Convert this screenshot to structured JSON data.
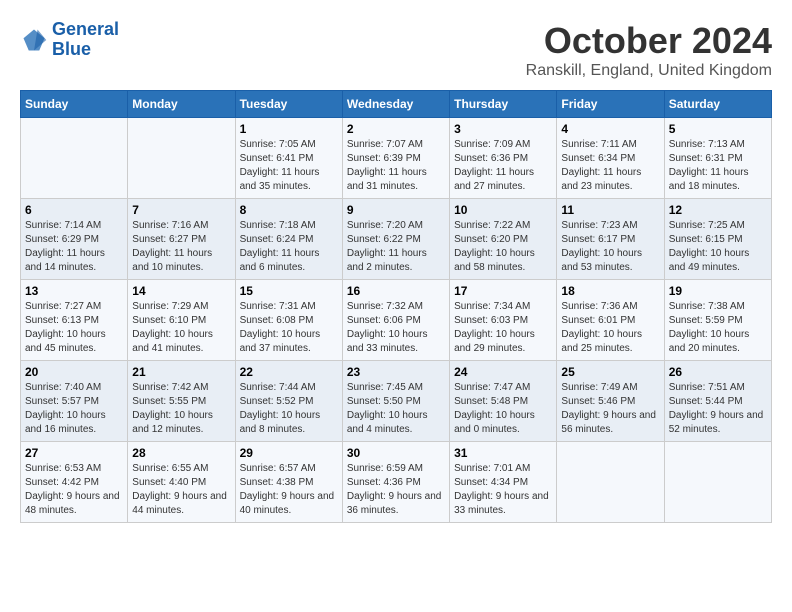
{
  "header": {
    "logo_line1": "General",
    "logo_line2": "Blue",
    "month_title": "October 2024",
    "location": "Ranskill, England, United Kingdom"
  },
  "columns": [
    "Sunday",
    "Monday",
    "Tuesday",
    "Wednesday",
    "Thursday",
    "Friday",
    "Saturday"
  ],
  "weeks": [
    [
      {
        "day": "",
        "info": ""
      },
      {
        "day": "",
        "info": ""
      },
      {
        "day": "1",
        "info": "Sunrise: 7:05 AM\nSunset: 6:41 PM\nDaylight: 11 hours and 35 minutes."
      },
      {
        "day": "2",
        "info": "Sunrise: 7:07 AM\nSunset: 6:39 PM\nDaylight: 11 hours and 31 minutes."
      },
      {
        "day": "3",
        "info": "Sunrise: 7:09 AM\nSunset: 6:36 PM\nDaylight: 11 hours and 27 minutes."
      },
      {
        "day": "4",
        "info": "Sunrise: 7:11 AM\nSunset: 6:34 PM\nDaylight: 11 hours and 23 minutes."
      },
      {
        "day": "5",
        "info": "Sunrise: 7:13 AM\nSunset: 6:31 PM\nDaylight: 11 hours and 18 minutes."
      }
    ],
    [
      {
        "day": "6",
        "info": "Sunrise: 7:14 AM\nSunset: 6:29 PM\nDaylight: 11 hours and 14 minutes."
      },
      {
        "day": "7",
        "info": "Sunrise: 7:16 AM\nSunset: 6:27 PM\nDaylight: 11 hours and 10 minutes."
      },
      {
        "day": "8",
        "info": "Sunrise: 7:18 AM\nSunset: 6:24 PM\nDaylight: 11 hours and 6 minutes."
      },
      {
        "day": "9",
        "info": "Sunrise: 7:20 AM\nSunset: 6:22 PM\nDaylight: 11 hours and 2 minutes."
      },
      {
        "day": "10",
        "info": "Sunrise: 7:22 AM\nSunset: 6:20 PM\nDaylight: 10 hours and 58 minutes."
      },
      {
        "day": "11",
        "info": "Sunrise: 7:23 AM\nSunset: 6:17 PM\nDaylight: 10 hours and 53 minutes."
      },
      {
        "day": "12",
        "info": "Sunrise: 7:25 AM\nSunset: 6:15 PM\nDaylight: 10 hours and 49 minutes."
      }
    ],
    [
      {
        "day": "13",
        "info": "Sunrise: 7:27 AM\nSunset: 6:13 PM\nDaylight: 10 hours and 45 minutes."
      },
      {
        "day": "14",
        "info": "Sunrise: 7:29 AM\nSunset: 6:10 PM\nDaylight: 10 hours and 41 minutes."
      },
      {
        "day": "15",
        "info": "Sunrise: 7:31 AM\nSunset: 6:08 PM\nDaylight: 10 hours and 37 minutes."
      },
      {
        "day": "16",
        "info": "Sunrise: 7:32 AM\nSunset: 6:06 PM\nDaylight: 10 hours and 33 minutes."
      },
      {
        "day": "17",
        "info": "Sunrise: 7:34 AM\nSunset: 6:03 PM\nDaylight: 10 hours and 29 minutes."
      },
      {
        "day": "18",
        "info": "Sunrise: 7:36 AM\nSunset: 6:01 PM\nDaylight: 10 hours and 25 minutes."
      },
      {
        "day": "19",
        "info": "Sunrise: 7:38 AM\nSunset: 5:59 PM\nDaylight: 10 hours and 20 minutes."
      }
    ],
    [
      {
        "day": "20",
        "info": "Sunrise: 7:40 AM\nSunset: 5:57 PM\nDaylight: 10 hours and 16 minutes."
      },
      {
        "day": "21",
        "info": "Sunrise: 7:42 AM\nSunset: 5:55 PM\nDaylight: 10 hours and 12 minutes."
      },
      {
        "day": "22",
        "info": "Sunrise: 7:44 AM\nSunset: 5:52 PM\nDaylight: 10 hours and 8 minutes."
      },
      {
        "day": "23",
        "info": "Sunrise: 7:45 AM\nSunset: 5:50 PM\nDaylight: 10 hours and 4 minutes."
      },
      {
        "day": "24",
        "info": "Sunrise: 7:47 AM\nSunset: 5:48 PM\nDaylight: 10 hours and 0 minutes."
      },
      {
        "day": "25",
        "info": "Sunrise: 7:49 AM\nSunset: 5:46 PM\nDaylight: 9 hours and 56 minutes."
      },
      {
        "day": "26",
        "info": "Sunrise: 7:51 AM\nSunset: 5:44 PM\nDaylight: 9 hours and 52 minutes."
      }
    ],
    [
      {
        "day": "27",
        "info": "Sunrise: 6:53 AM\nSunset: 4:42 PM\nDaylight: 9 hours and 48 minutes."
      },
      {
        "day": "28",
        "info": "Sunrise: 6:55 AM\nSunset: 4:40 PM\nDaylight: 9 hours and 44 minutes."
      },
      {
        "day": "29",
        "info": "Sunrise: 6:57 AM\nSunset: 4:38 PM\nDaylight: 9 hours and 40 minutes."
      },
      {
        "day": "30",
        "info": "Sunrise: 6:59 AM\nSunset: 4:36 PM\nDaylight: 9 hours and 36 minutes."
      },
      {
        "day": "31",
        "info": "Sunrise: 7:01 AM\nSunset: 4:34 PM\nDaylight: 9 hours and 33 minutes."
      },
      {
        "day": "",
        "info": ""
      },
      {
        "day": "",
        "info": ""
      }
    ]
  ]
}
